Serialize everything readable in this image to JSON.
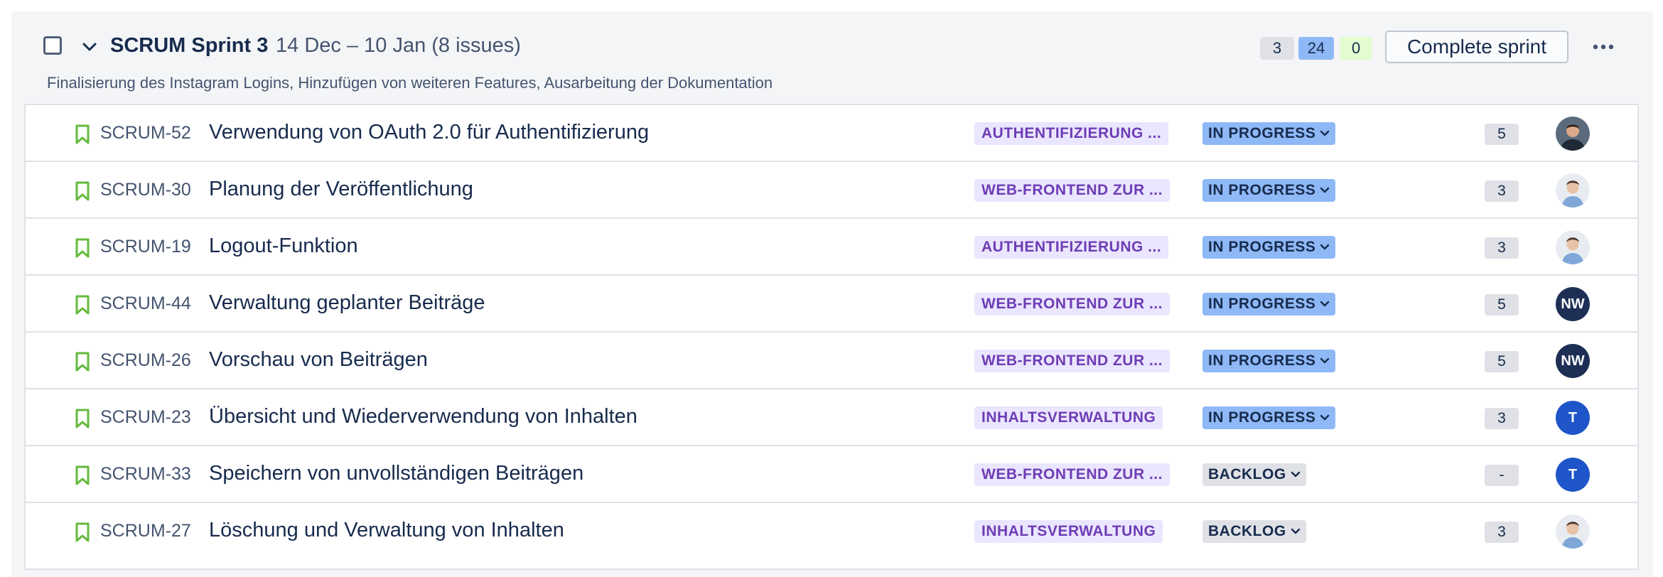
{
  "sprint": {
    "name": "SCRUM Sprint 3",
    "dates": "14 Dec – 10 Jan (8 issues)",
    "goal": "Finalisierung des Instagram Logins, Hinzufügen von weiteren Features, Ausarbeitung der Dokumentation",
    "counts": {
      "todo": "3",
      "in_progress": "24",
      "done": "0"
    },
    "complete_label": "Complete sprint",
    "more_icon": "ellipsis-icon",
    "colors": {
      "todo": "#dfe1e6",
      "in_progress": "#8fb8f6",
      "done": "#e3fcd0",
      "epic_bg": "#eae6ff",
      "epic_text": "#6e3cb5",
      "story_icon": "#63ba3c"
    }
  },
  "issues": [
    {
      "key": "SCRUM-52",
      "summary": "Verwendung von OAuth 2.0 für Authentifizierung",
      "epic": "AUTHENTIFIZIERUNG ...",
      "status": "IN PROGRESS",
      "points": "5",
      "assignee": {
        "type": "photo-dark",
        "initials": ""
      }
    },
    {
      "key": "SCRUM-30",
      "summary": "Planung der Veröffentlichung",
      "epic": "WEB-FRONTEND ZUR ...",
      "status": "IN PROGRESS",
      "points": "3",
      "assignee": {
        "type": "photo-light",
        "initials": ""
      }
    },
    {
      "key": "SCRUM-19",
      "summary": "Logout-Funktion",
      "epic": "AUTHENTIFIZIERUNG ...",
      "status": "IN PROGRESS",
      "points": "3",
      "assignee": {
        "type": "photo-light",
        "initials": ""
      }
    },
    {
      "key": "SCRUM-44",
      "summary": "Verwaltung geplanter Beiträge",
      "epic": "WEB-FRONTEND ZUR ...",
      "status": "IN PROGRESS",
      "points": "5",
      "assignee": {
        "type": "initials",
        "initials": "NW",
        "color": "#1d2f55"
      }
    },
    {
      "key": "SCRUM-26",
      "summary": "Vorschau von Beiträgen",
      "epic": "WEB-FRONTEND ZUR ...",
      "status": "IN PROGRESS",
      "points": "5",
      "assignee": {
        "type": "initials",
        "initials": "NW",
        "color": "#1d2f55"
      }
    },
    {
      "key": "SCRUM-23",
      "summary": "Übersicht und Wiederverwendung von Inhalten",
      "epic": "INHALTSVERWALTUNG",
      "status": "IN PROGRESS",
      "points": "3",
      "assignee": {
        "type": "initials",
        "initials": "T",
        "color": "#1e55c8"
      }
    },
    {
      "key": "SCRUM-33",
      "summary": "Speichern von unvollständigen Beiträgen",
      "epic": "WEB-FRONTEND ZUR ...",
      "status": "BACKLOG",
      "points": "-",
      "assignee": {
        "type": "initials",
        "initials": "T",
        "color": "#1e55c8"
      }
    },
    {
      "key": "SCRUM-27",
      "summary": "Löschung und Verwaltung von Inhalten",
      "epic": "INHALTSVERWALTUNG",
      "status": "BACKLOG",
      "points": "3",
      "assignee": {
        "type": "photo-light",
        "initials": ""
      }
    }
  ]
}
